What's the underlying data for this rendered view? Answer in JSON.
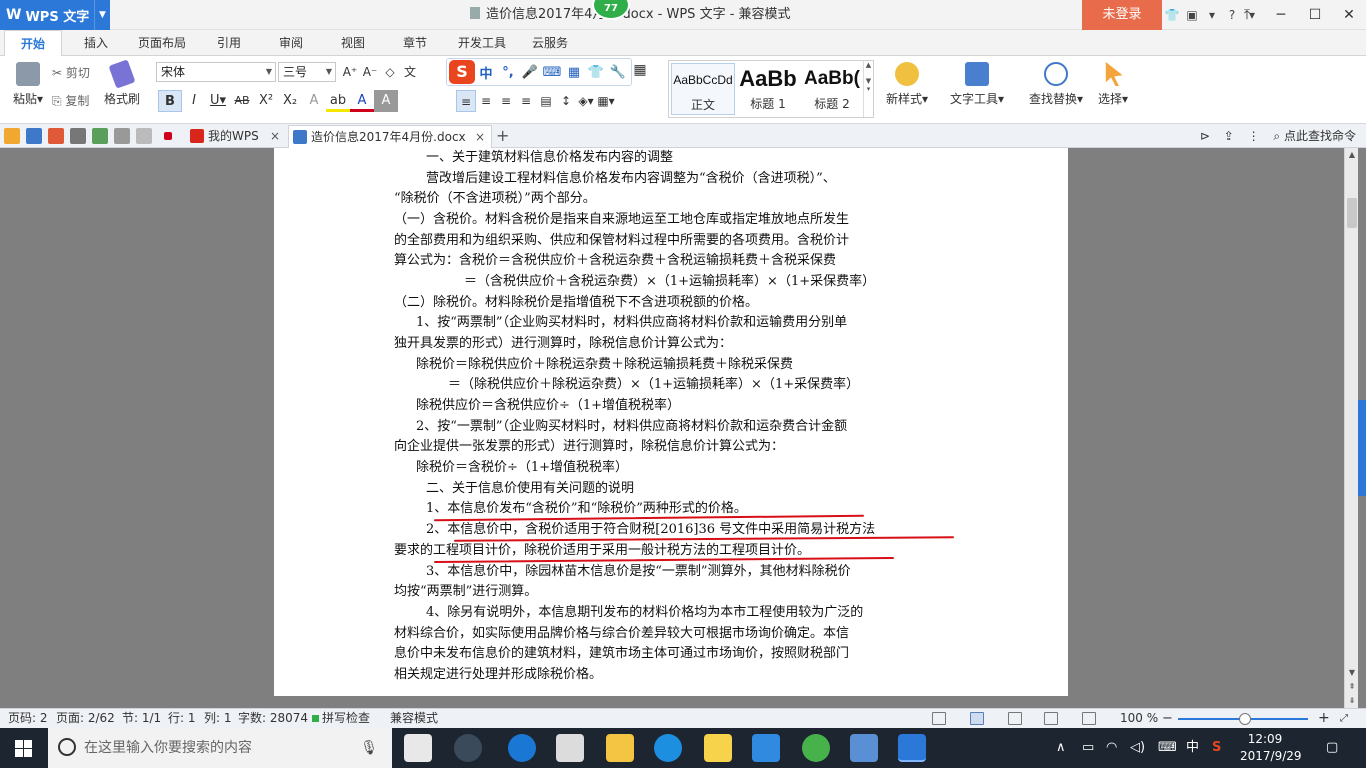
{
  "titlebar": {
    "app_name": "WPS 文字",
    "window_title": "造价信息2017年4月份.docx - WPS 文字 - 兼容模式",
    "badge": "77",
    "login_label": "未登录"
  },
  "menu": {
    "items": [
      "开始",
      "插入",
      "页面布局",
      "引用",
      "审阅",
      "视图",
      "章节",
      "开发工具",
      "云服务"
    ],
    "active": "开始"
  },
  "ribbon": {
    "paste": "粘贴",
    "cut": "剪切",
    "copy": "复制",
    "format_painter": "格式刷",
    "font_name": "宋体",
    "font_size": "三号",
    "styles": [
      {
        "sample": "AaBbCcDd",
        "label": "正文"
      },
      {
        "sample": "AaBb",
        "label": "标题 1"
      },
      {
        "sample": "AaBb(",
        "label": "标题 2"
      }
    ],
    "new_style": "新样式",
    "text_tools": "文字工具",
    "find_replace": "查找替换",
    "select": "选择"
  },
  "tabs": {
    "home_tab": "我的WPS",
    "doc_tab": "造价信息2017年4月份.docx",
    "search_cmd": "点此查找命令"
  },
  "document": {
    "lines": [
      "一、关于建筑材料信息价格发布内容的调整",
      "营改增后建设工程材料信息价格发布内容调整为“含税价（含进项税）”、",
      "“除税价（不含进项税）”两个部分。",
      "（一）含税价。材料含税价是指来自来源地运至工地仓库或指定堆放地点所发生",
      "的全部费用和为组织采购、供应和保管材料过程中所需要的各项费用。含税价计",
      "算公式为：含税价＝含税供应价＋含税运杂费＋含税运输损耗费＋含税采保费",
      "＝（含税供应价＋含税运杂费）×（1+运输损耗率）×（1+采保费率）",
      "（二）除税价。材料除税价是指增值税下不含进项税额的价格。",
      "1、按“两票制”（企业购买材料时，材料供应商将材料价款和运输费用分别单",
      "独开具发票的形式）进行测算时，除税信息价计算公式为：",
      "除税价＝除税供应价＋除税运杂费＋除税运输损耗费＋除税采保费",
      "＝（除税供应价＋除税运杂费）×（1+运输损耗率）×（1+采保费率）",
      "除税供应价＝含税供应价÷（1+增值税税率）",
      "2、按“一票制”（企业购买材料时，材料供应商将材料价款和运杂费合计金额",
      "向企业提供一张发票的形式）进行测算时，除税信息价计算公式为：",
      "除税价＝含税价÷（1+增值税税率）",
      "二、关于信息价使用有关问题的说明",
      "1、本信息价发布“含税价”和“除税价”两种形式的价格。",
      "2、本信息价中，含税价适用于符合财税[2016]36 号文件中采用简易计税方法",
      "要求的工程项目计价，除税价适用于采用一般计税方法的工程项目计价。",
      "3、本信息价中，除园林苗木信息价是按“一票制”测算外，其他材料除税价",
      "均按“两票制”进行测算。",
      "4、除另有说明外，本信息期刊发布的材料价格均为本市工程使用较为广泛的",
      "材料综合价，如实际使用品牌价格与综合价差异较大可根据市场询价确定。本信",
      "息价中未发布信息价的建筑材料，建筑市场主体可通过市场询价，按照财税部门",
      "相关规定进行处理并形成除税价格。"
    ]
  },
  "status": {
    "page_code": "页码: 2",
    "pages": "页面: 2/62",
    "section": "节: 1/1",
    "row": "行: 1",
    "col": "列: 1",
    "words": "字数: 28074",
    "spell": "拼写检查",
    "compat": "兼容模式",
    "zoom": "100 %",
    "zoom_minus": "−",
    "zoom_plus": "+"
  },
  "taskbar": {
    "search_placeholder": "在这里输入你要搜索的内容",
    "ime": "中",
    "time": "12:09",
    "date": "2017/9/29"
  }
}
